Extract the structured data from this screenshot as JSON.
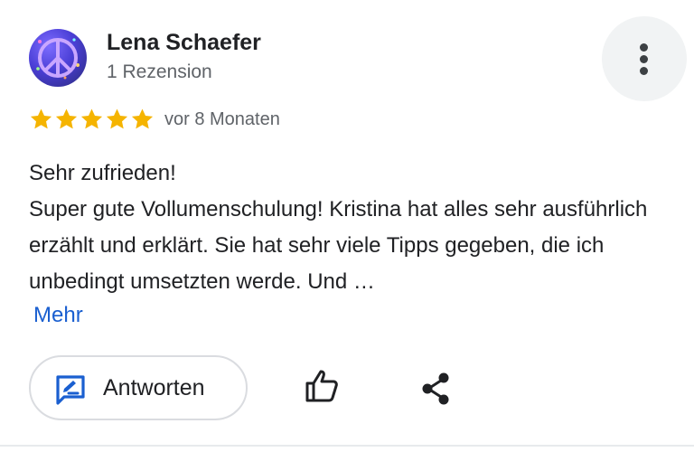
{
  "reviewer": {
    "name": "Lena Schaefer",
    "review_count": "1 Rezension",
    "avatar_icon": "peace-sign-avatar"
  },
  "rating": {
    "stars": 5,
    "max": 5,
    "star_color": "#f5b400"
  },
  "date": "vor 8 Monaten",
  "review": {
    "title": "Sehr zufrieden!",
    "body": "Super gute Vollumenschulung! Kristina hat alles sehr ausführlich erzählt und erklärt. Sie hat sehr viele Tipps gegeben, die ich unbedingt umsetzten werde. Und …"
  },
  "more_link": "Mehr",
  "actions": {
    "reply_label": "Antworten",
    "reply_icon": "reply-edit-icon",
    "like_icon": "thumbs-up-icon",
    "share_icon": "share-icon",
    "menu_icon": "more-vert-icon"
  },
  "colors": {
    "link": "#1a5fd0",
    "accent_icon": "#1a5fd0"
  }
}
